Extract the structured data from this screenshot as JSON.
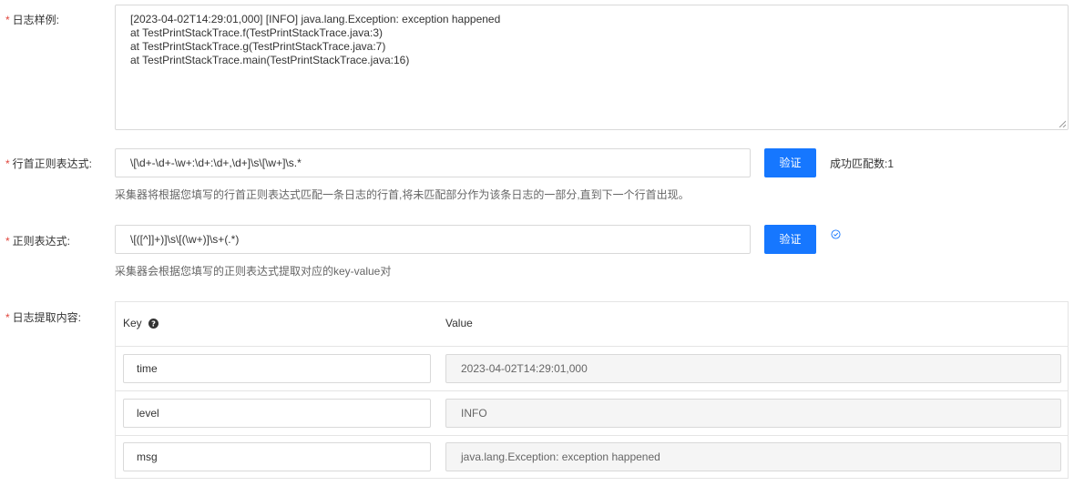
{
  "log_sample": {
    "label": "日志样例:",
    "lines": [
      "[2023-04-02T14:29:01,000] [INFO] java.lang.Exception: exception happened",
      "at TestPrintStackTrace.f(TestPrintStackTrace.java:3)",
      "at TestPrintStackTrace.g(TestPrintStackTrace.java:7)",
      "at TestPrintStackTrace.main(TestPrintStackTrace.java:16)"
    ]
  },
  "line_start_regex": {
    "label": "行首正则表达式:",
    "value": "\\[\\d+-\\d+-\\w+:\\d+:\\d+,\\d+]\\s\\[\\w+]\\s.*",
    "button": "验证",
    "status": "成功匹配数:1",
    "hint": "采集器将根据您填写的行首正则表达式匹配一条日志的行首,将未匹配部分作为该条日志的一部分,直到下一个行首出现。"
  },
  "regex": {
    "label": "正则表达式:",
    "value": "\\[([^]]+)]\\s\\[(\\w+)]\\s+(.*)",
    "button": "验证",
    "status_icon": "check-circle-icon",
    "hint": "采集器会根据您填写的正则表达式提取对应的key-value对"
  },
  "extract": {
    "label": "日志提取内容:",
    "key_header": "Key",
    "value_header": "Value",
    "rows": [
      {
        "key": "time",
        "value": "2023-04-02T14:29:01,000"
      },
      {
        "key": "level",
        "value": "INFO"
      },
      {
        "key": "msg",
        "value": "java.lang.Exception: exception happened"
      }
    ]
  },
  "colors": {
    "primary": "#1677ff",
    "required": "#e0453c"
  }
}
